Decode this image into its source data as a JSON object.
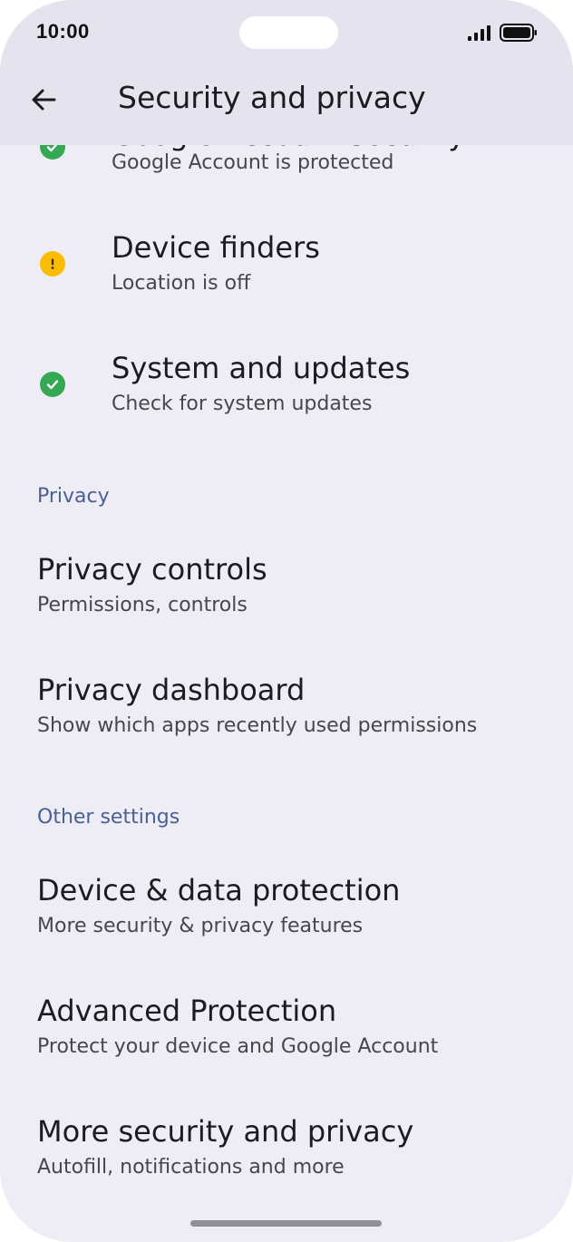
{
  "status_bar": {
    "time": "10:00"
  },
  "app_bar": {
    "title": "Security and privacy",
    "back_icon": "arrow-back-icon"
  },
  "security_items": [
    {
      "title": "Google Account security",
      "subtitle": "Google Account is protected",
      "status": "ok",
      "status_color": "#34a853"
    },
    {
      "title": "Device finders",
      "subtitle": "Location is off",
      "status": "warning",
      "status_color": "#fbbc04"
    },
    {
      "title": "System and updates",
      "subtitle": "Check for system updates",
      "status": "ok",
      "status_color": "#34a853"
    }
  ],
  "privacy_section": {
    "header": "Privacy",
    "items": [
      {
        "title": "Privacy controls",
        "subtitle": "Permissions, controls"
      },
      {
        "title": "Privacy dashboard",
        "subtitle": "Show which apps recently used permissions"
      }
    ]
  },
  "other_section": {
    "header": "Other settings",
    "items": [
      {
        "title": "Device & data protection",
        "subtitle": "More security & privacy features"
      },
      {
        "title": "Advanced Protection",
        "subtitle": "Protect your device and Google Account"
      },
      {
        "title": "More security and privacy",
        "subtitle": "Autofill, notifications and more"
      }
    ]
  },
  "colors": {
    "background": "#eeedf5",
    "app_bar": "#e4e3ee",
    "section_header": "#4a5f94",
    "ok": "#34a853",
    "warning": "#fbbc04"
  }
}
